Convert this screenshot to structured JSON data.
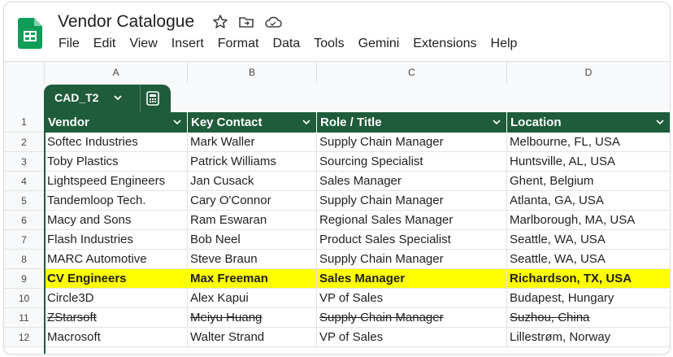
{
  "app": {
    "title": "Vendor Catalogue"
  },
  "menu": [
    "File",
    "Edit",
    "View",
    "Insert",
    "Format",
    "Data",
    "Tools",
    "Gemini",
    "Extensions",
    "Help"
  ],
  "columns": [
    "A",
    "B",
    "C",
    "D"
  ],
  "table": {
    "name": "CAD_T2",
    "headers": [
      "Vendor",
      "Key Contact",
      "Role / Title",
      "Location"
    ],
    "header_color": "#1f5c3c",
    "rows": [
      {
        "n": "2",
        "cells": [
          "Softec Industries",
          "Mark Waller",
          "Supply Chain Manager",
          "Melbourne, FL, USA"
        ]
      },
      {
        "n": "3",
        "cells": [
          "Toby Plastics",
          "Patrick Williams",
          "Sourcing Specialist",
          "Huntsville, AL, USA"
        ]
      },
      {
        "n": "4",
        "cells": [
          "Lightspeed Engineers",
          "Jan Cusack",
          "Sales Manager",
          "Ghent, Belgium"
        ]
      },
      {
        "n": "5",
        "cells": [
          "Tandemloop Tech.",
          "Cary O'Connor",
          "Supply Chain Manager",
          "Atlanta, GA, USA"
        ]
      },
      {
        "n": "6",
        "cells": [
          "Macy and Sons",
          "Ram Eswaran",
          "Regional Sales Manager",
          "Marlborough, MA, USA"
        ]
      },
      {
        "n": "7",
        "cells": [
          "Flash Industries",
          "Bob Neel",
          "Product Sales Specialist",
          "Seattle, WA, USA"
        ]
      },
      {
        "n": "8",
        "cells": [
          "MARC Automotive",
          "Steve Braun",
          "Supply Chain Manager",
          "Seattle, WA, USA"
        ]
      },
      {
        "n": "9",
        "cells": [
          "CV Engineers",
          "Max Freeman",
          "Sales Manager",
          "Richardson, TX, USA"
        ],
        "style": "highlight"
      },
      {
        "n": "10",
        "cells": [
          "Circle3D",
          "Alex Kapui",
          "VP of Sales",
          "Budapest, Hungary"
        ]
      },
      {
        "n": "11",
        "cells": [
          "ZStarsoft",
          "Meiyu Huang",
          "Supply Chain Manager",
          "Suzhou, China"
        ],
        "style": "strikethrough"
      },
      {
        "n": "12",
        "cells": [
          "Macrosoft",
          "Walter Strand",
          "VP of Sales",
          "Lillestrøm, Norway"
        ]
      }
    ]
  },
  "header_row_number": "1",
  "icons": {
    "logo": "sheets-logo-icon",
    "star": "star-icon",
    "move": "move-to-folder-icon",
    "cloud": "cloud-status-icon"
  },
  "highlight_color": "#ffff00"
}
